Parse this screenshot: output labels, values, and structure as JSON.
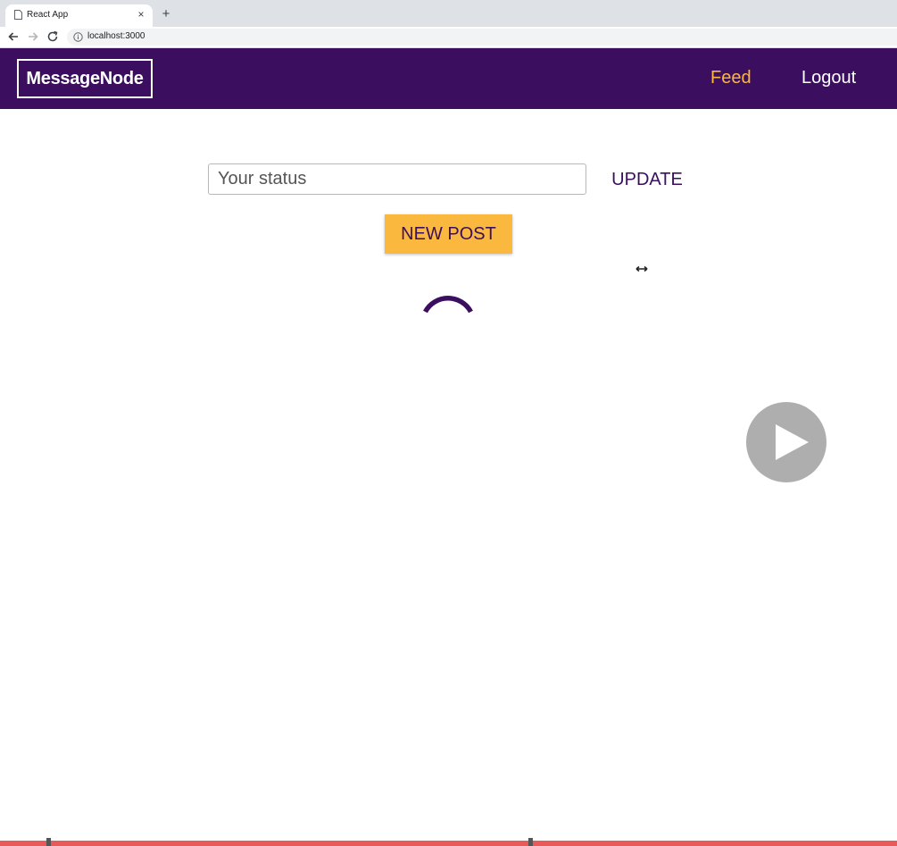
{
  "browser": {
    "tab_title": "React App",
    "tab_close": "×",
    "new_tab": "+",
    "url": "localhost:3000"
  },
  "header": {
    "logo": "MessageNode",
    "nav": [
      {
        "label": "Feed",
        "color": "#fab83f"
      },
      {
        "label": "Logout",
        "color": "#ffffff"
      }
    ],
    "background": "#3b0e5f"
  },
  "status": {
    "placeholder": "Your status",
    "value": "",
    "update_label": "UPDATE"
  },
  "new_post": {
    "label": "NEW POST",
    "color": "#fab83f"
  },
  "loading": {
    "spinner_color": "#3b0e5f"
  },
  "video_overlay": {
    "icon": "play-icon"
  },
  "progress": {
    "color": "#e85a5a"
  }
}
